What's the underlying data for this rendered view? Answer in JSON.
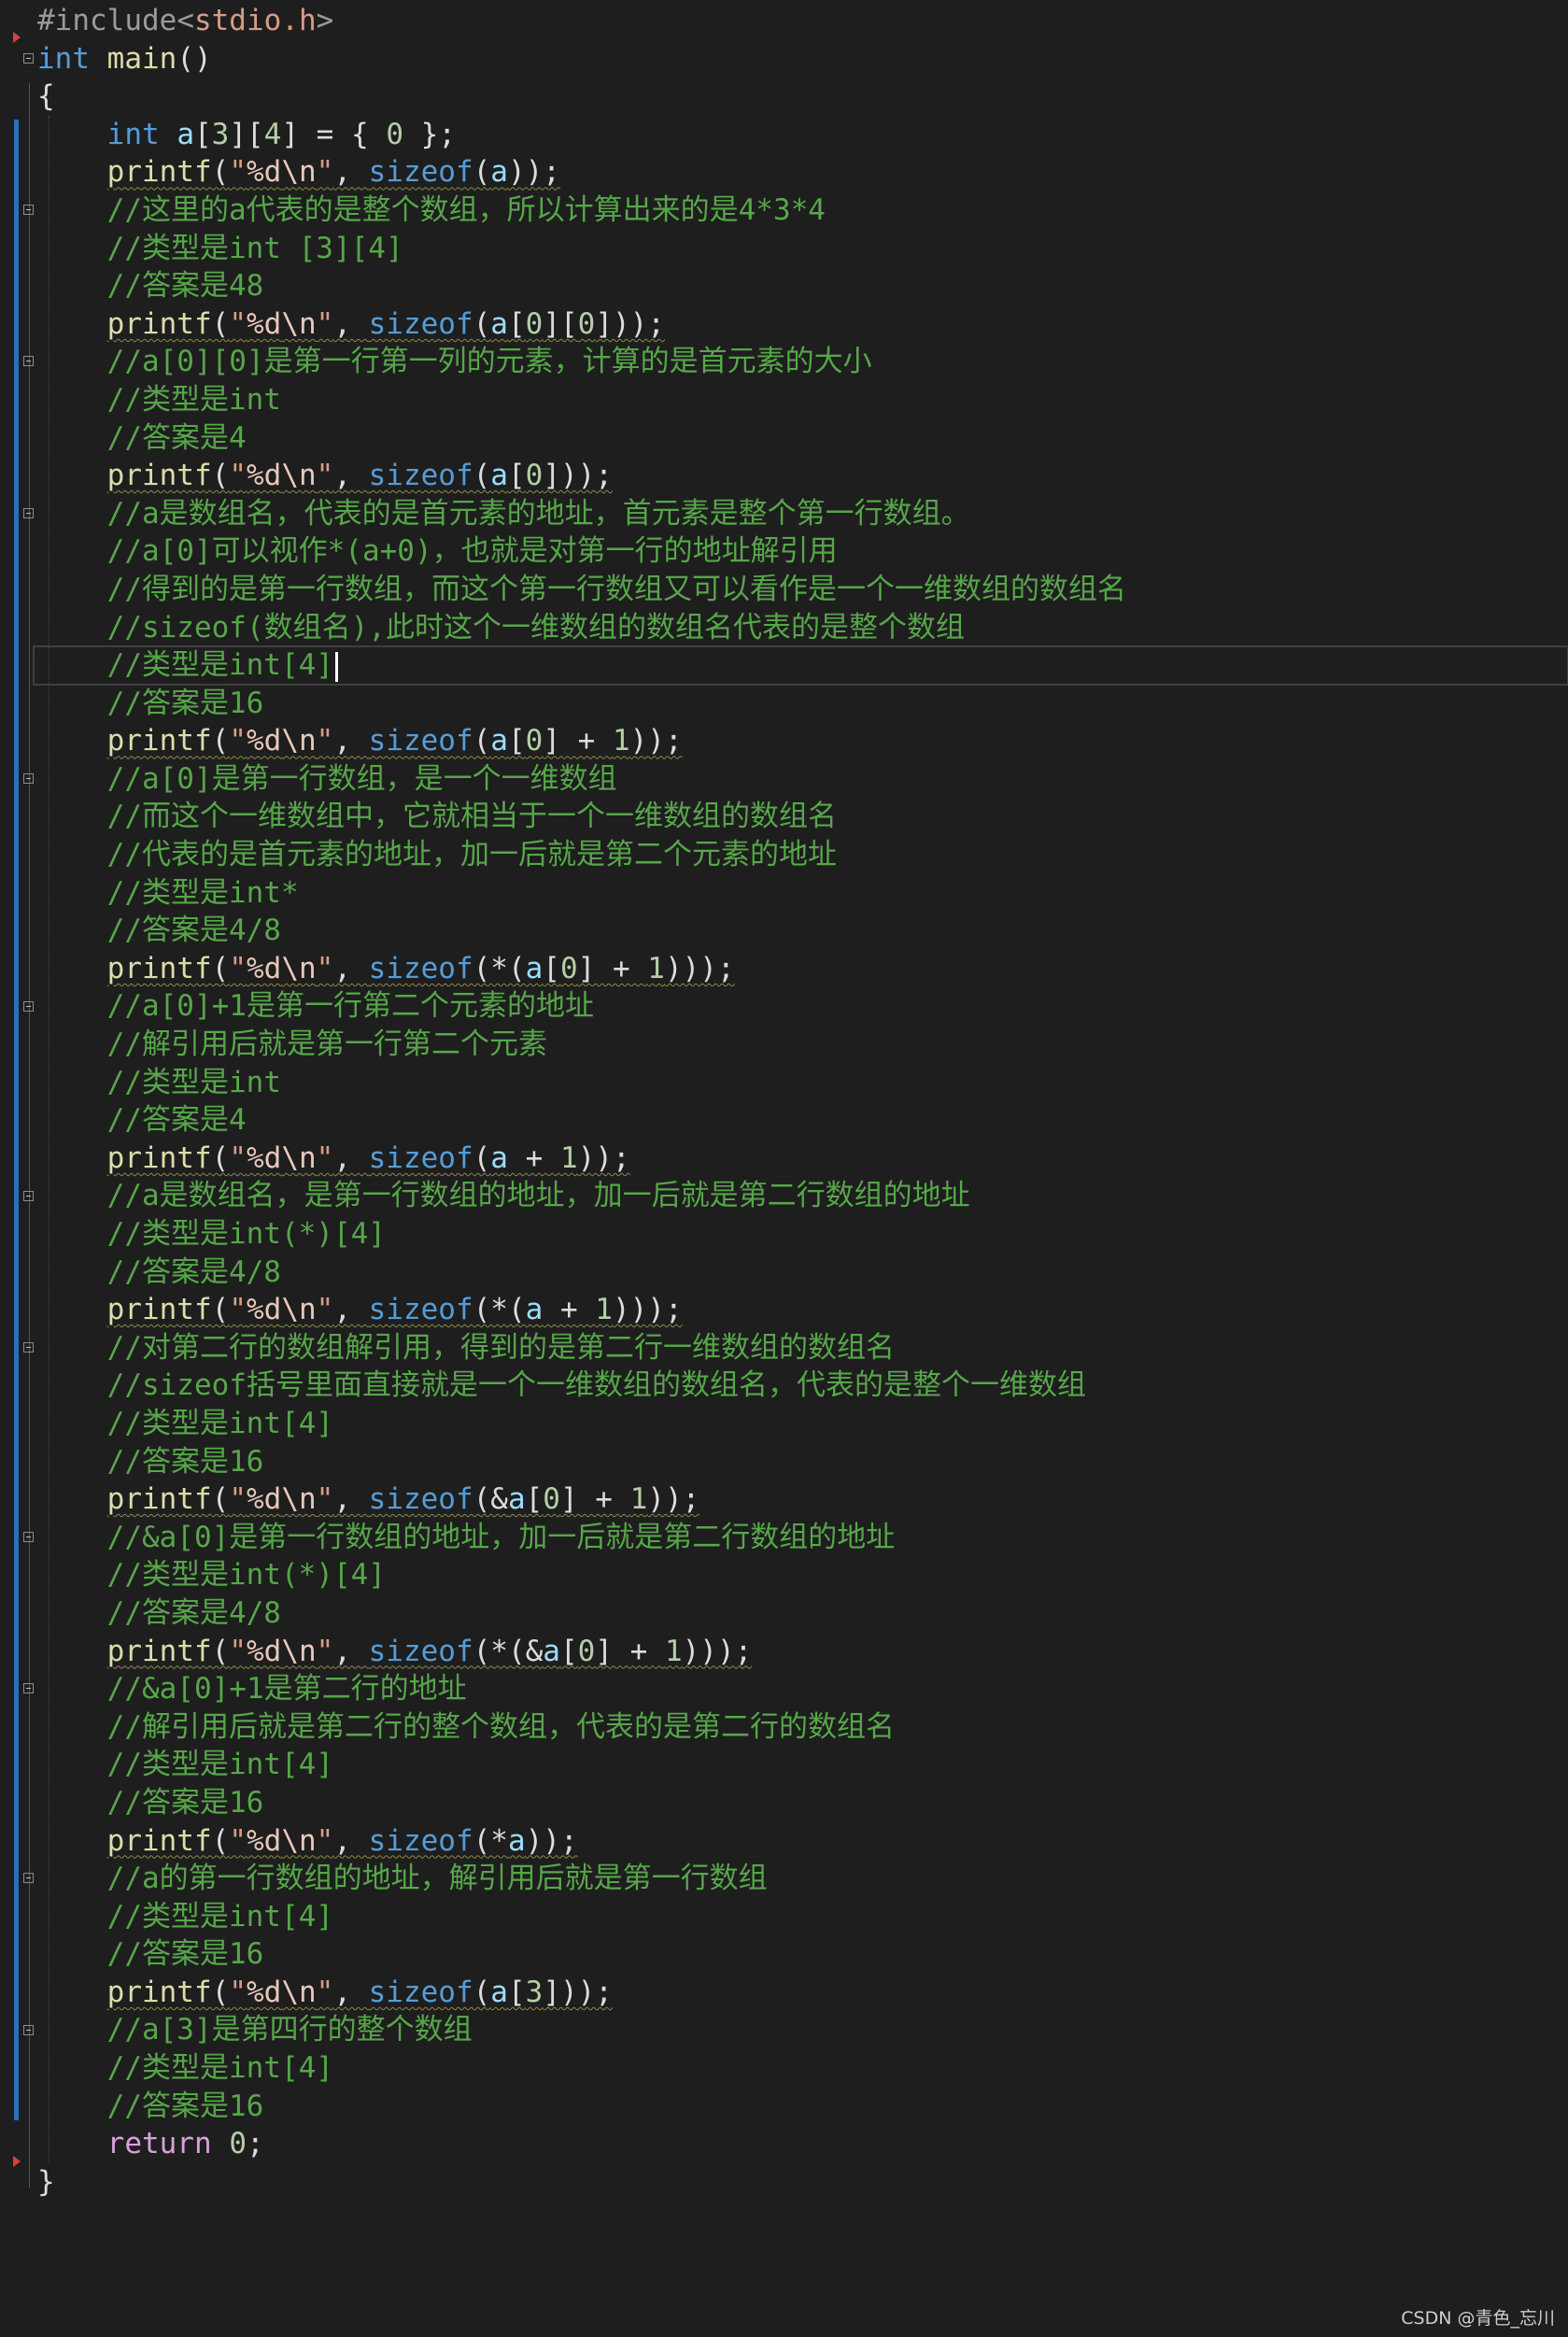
{
  "editor": {
    "lines": [
      "#include<stdio.h>",
      "int main()",
      "{",
      "    int a[3][4] = { 0 };",
      "    printf(\"%d\\n\", sizeof(a));",
      "    //这里的a代表的是整个数组，所以计算出来的是4*3*4",
      "    //类型是int [3][4]",
      "    //答案是48",
      "    printf(\"%d\\n\", sizeof(a[0][0]));",
      "    //a[0][0]是第一行第一列的元素，计算的是首元素的大小",
      "    //类型是int",
      "    //答案是4",
      "    printf(\"%d\\n\", sizeof(a[0]));",
      "    //a是数组名，代表的是首元素的地址，首元素是整个第一行数组。",
      "    //a[0]可以视作*(a+0)，也就是对第一行的地址解引用",
      "    //得到的是第一行数组，而这个第一行数组又可以看作是一个一维数组的数组名",
      "    //sizeof(数组名),此时这个一维数组的数组名代表的是整个数组",
      "    //类型是int[4]",
      "    //答案是16",
      "    printf(\"%d\\n\", sizeof(a[0] + 1));",
      "    //a[0]是第一行数组，是一个一维数组",
      "    //而这个一维数组中，它就相当于一个一维数组的数组名",
      "    //代表的是首元素的地址，加一后就是第二个元素的地址",
      "    //类型是int*",
      "    //答案是4/8",
      "    printf(\"%d\\n\", sizeof(*(a[0] + 1)));",
      "    //a[0]+1是第一行第二个元素的地址",
      "    //解引用后就是第一行第二个元素",
      "    //类型是int",
      "    //答案是4",
      "    printf(\"%d\\n\", sizeof(a + 1));",
      "    //a是数组名，是第一行数组的地址，加一后就是第二行数组的地址",
      "    //类型是int(*)[4]",
      "    //答案是4/8",
      "    printf(\"%d\\n\", sizeof(*(a + 1)));",
      "    //对第二行的数组解引用，得到的是第二行一维数组的数组名",
      "    //sizeof括号里面直接就是一个一维数组的数组名，代表的是整个一维数组",
      "    //类型是int[4]",
      "    //答案是16",
      "    printf(\"%d\\n\", sizeof(&a[0] + 1));",
      "    //&a[0]是第一行数组的地址，加一后就是第二行数组的地址",
      "    //类型是int(*)[4]",
      "    //答案是4/8",
      "    printf(\"%d\\n\", sizeof(*(&a[0] + 1)));",
      "    //&a[0]+1是第二行的地址",
      "    //解引用后就是第二行的整个数组，代表的是第二行的数组名",
      "    //类型是int[4]",
      "    //答案是16",
      "    printf(\"%d\\n\", sizeof(*a));",
      "    //a的第一行数组的地址，解引用后就是第一行数组",
      "    //类型是int[4]",
      "    //答案是16",
      "    printf(\"%d\\n\", sizeof(a[3]));",
      "    //a[3]是第四行的整个数组",
      "    //类型是int[4]",
      "    //答案是16",
      "    return 0;",
      "}"
    ],
    "current_line": 17
  },
  "watermark": "CSDN @青色_忘川",
  "colors": {
    "background": "#1e1e1e",
    "keyword": "#569cd6",
    "function": "#dcdcaa",
    "string": "#d69d85",
    "comment": "#57a64a",
    "change_bar": "#2a6fbf",
    "breakpoint_marker": "#d94040"
  },
  "icons": [
    "fold-collapse-icon",
    "breakpoint-arrow-icon"
  ]
}
